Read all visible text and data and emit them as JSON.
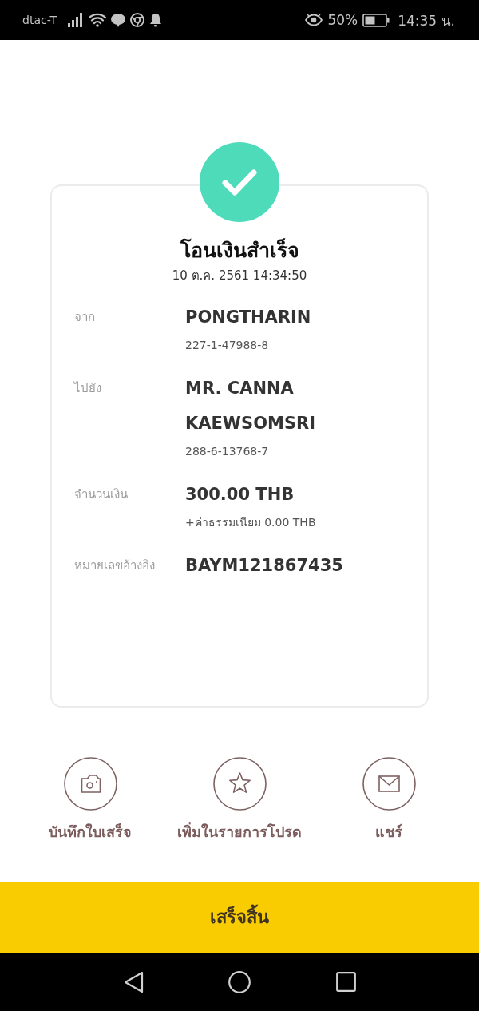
{
  "status_bar": {
    "carrier": "dtac-T",
    "battery": "50%",
    "time": "14:35 น."
  },
  "receipt": {
    "title": "โอนเงินสำเร็จ",
    "datetime": "10 ต.ค. 2561 14:34:50",
    "rows": [
      {
        "label": "จาก",
        "value_lines": [
          "PONGTHARIN"
        ],
        "detail": "227-1-47988-8"
      },
      {
        "label": "ไปยัง",
        "value_lines": [
          "MR. CANNA",
          "KAEWSOMSRI"
        ],
        "detail": "288-6-13768-7"
      },
      {
        "label": "จำนวนเงิน",
        "value_lines": [
          "300.00 THB"
        ],
        "detail": "+ค่าธรรมเนียม 0.00 THB"
      },
      {
        "label": "หมายเลขอ้างอิง",
        "value_lines": [
          "BAYM121867435"
        ]
      }
    ]
  },
  "actions": [
    {
      "kind": "camera",
      "label": "บันทึกใบเสร็จ"
    },
    {
      "kind": "star",
      "label": "เพิ่มในรายการโปรด"
    },
    {
      "kind": "mail",
      "label": "แชร์"
    }
  ],
  "done_button": {
    "label": "เสร็จสิ้น"
  }
}
